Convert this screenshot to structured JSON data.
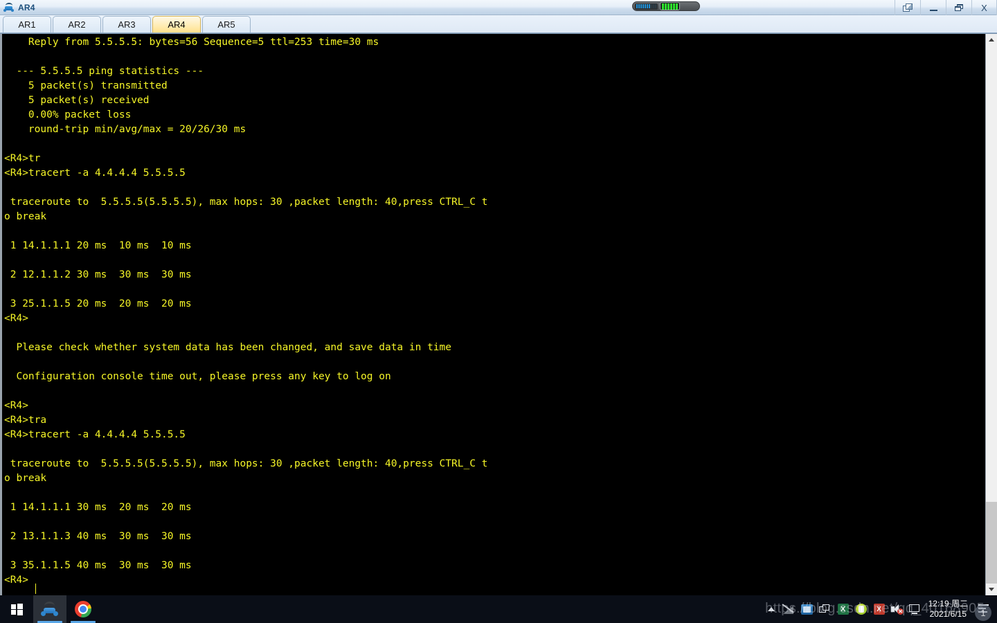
{
  "window": {
    "title": "AR4",
    "icon": "router-icon",
    "buttons": [
      {
        "name": "cascade-windows-button",
        "label": ""
      },
      {
        "name": "minimize-button",
        "label": ""
      },
      {
        "name": "maximize-button",
        "label": ""
      },
      {
        "name": "close-button",
        "label": "X"
      }
    ]
  },
  "tabs": [
    {
      "label": "AR1",
      "active": false
    },
    {
      "label": "AR2",
      "active": false
    },
    {
      "label": "AR3",
      "active": false
    },
    {
      "label": "AR4",
      "active": true
    },
    {
      "label": "AR5",
      "active": false
    }
  ],
  "terminal": {
    "prompt": "<R4>",
    "text": "    Reply from 5.5.5.5: bytes=56 Sequence=5 ttl=253 time=30 ms\n\n  --- 5.5.5.5 ping statistics ---\n    5 packet(s) transmitted\n    5 packet(s) received\n    0.00% packet loss\n    round-trip min/avg/max = 20/26/30 ms\n\n<R4>tr\n<R4>tracert -a 4.4.4.4 5.5.5.5\n\n traceroute to  5.5.5.5(5.5.5.5), max hops: 30 ,packet length: 40,press CTRL_C t\no break\n\n 1 14.1.1.1 20 ms  10 ms  10 ms\n\n 2 12.1.1.2 30 ms  30 ms  30 ms\n\n 3 25.1.1.5 20 ms  20 ms  20 ms\n<R4>\n\n  Please check whether system data has been changed, and save data in time\n\n  Configuration console time out, please press any key to log on\n\n<R4>\n<R4>tra\n<R4>tracert -a 4.4.4.4 5.5.5.5\n\n traceroute to  5.5.5.5(5.5.5.5), max hops: 30 ,packet length: 40,press CTRL_C t\no break\n\n 1 14.1.1.1 30 ms  20 ms  20 ms\n\n 2 13.1.1.3 40 ms  30 ms  30 ms\n\n 3 35.1.1.5 40 ms  30 ms  30 ms\n<R4>",
    "foreground_color": "#f5f527",
    "background_color": "#000000"
  },
  "taskbar": {
    "start": {
      "name": "start-button",
      "icon": "windows-logo-icon"
    },
    "items": [
      {
        "name": "taskbar-item-ensp",
        "icon": "ensp-router-icon",
        "active": true
      },
      {
        "name": "taskbar-item-chrome",
        "icon": "chrome-icon",
        "active": false
      }
    ],
    "tray_icons": [
      {
        "name": "show-hidden-icons",
        "icon": "chevron-up-icon"
      },
      {
        "name": "network-disconnected",
        "icon": "network-off-icon"
      },
      {
        "name": "network-adapter",
        "icon": "network-blue-icon"
      },
      {
        "name": "window-stack",
        "icon": "windows-stack-icon"
      },
      {
        "name": "excel-tray",
        "icon": "excel-icon"
      },
      {
        "name": "green-app-tray",
        "icon": "green-app-icon"
      },
      {
        "name": "office-tray",
        "icon": "office-icon"
      },
      {
        "name": "volume-muted",
        "icon": "volume-mute-icon"
      },
      {
        "name": "display-settings",
        "icon": "monitor-icon"
      }
    ],
    "clock": {
      "time": "12:19 周二",
      "date": "2021/6/15"
    },
    "action_center": {
      "name": "action-center-button",
      "icon": "notifications-icon"
    }
  },
  "watermark": {
    "text": "https.//blog.csdn.net/qq_40168905",
    "badge": "1"
  }
}
